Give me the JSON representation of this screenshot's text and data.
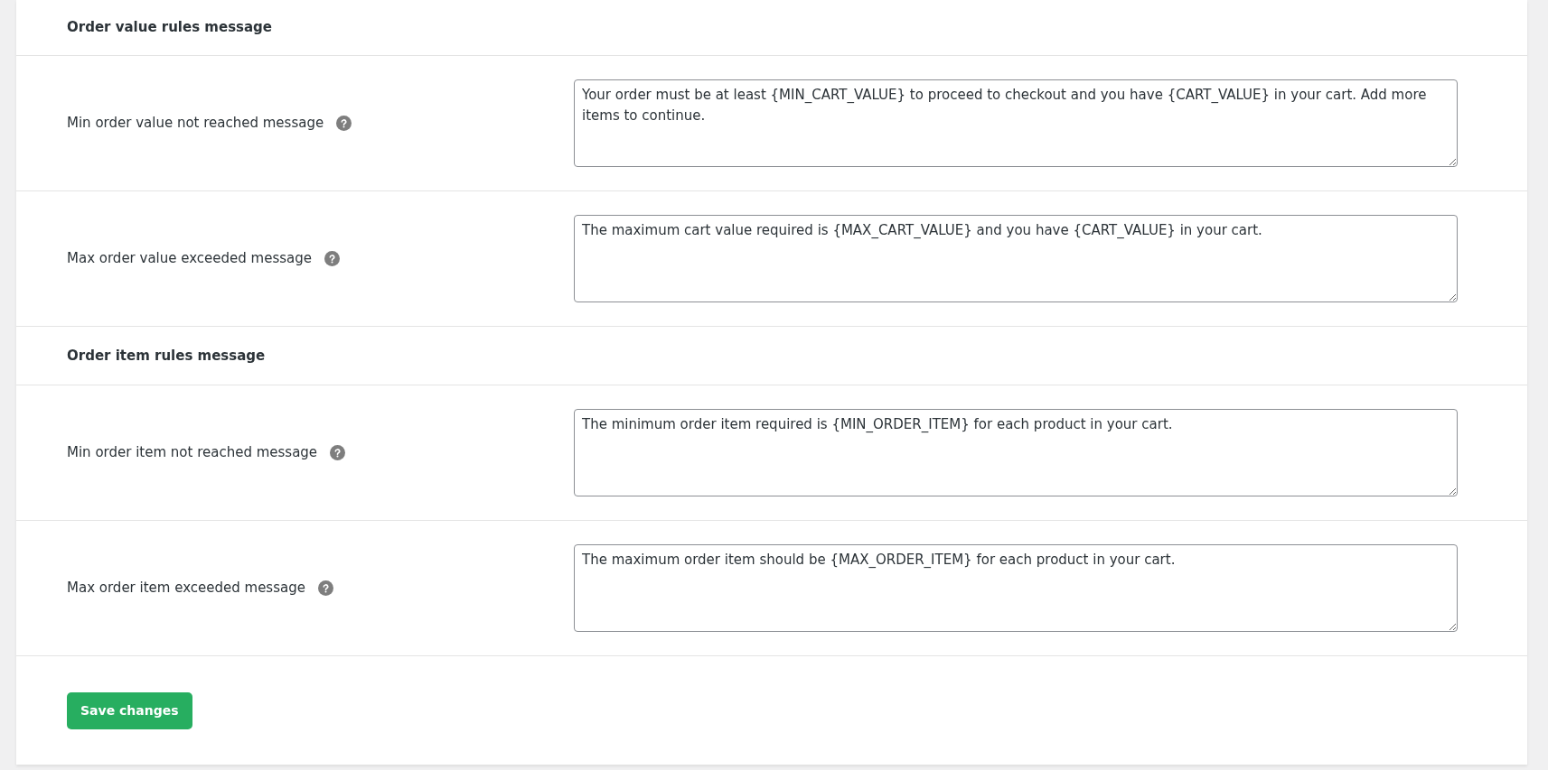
{
  "sections": [
    {
      "title": "Order value rules message",
      "fields": [
        {
          "label": "Min order value not reached message",
          "value": "Your order must be at least {MIN_CART_VALUE} to proceed to checkout and you have {CART_VALUE} in your cart. Add more items to continue."
        },
        {
          "label": "Max order value exceeded message",
          "value": "The maximum cart value required is {MAX_CART_VALUE} and you have {CART_VALUE} in your cart."
        }
      ]
    },
    {
      "title": "Order item rules message",
      "fields": [
        {
          "label": "Min order item not reached message",
          "value": "The minimum order item required is {MIN_ORDER_ITEM} for each product in your cart."
        },
        {
          "label": "Max order item exceeded message",
          "value": "The maximum order item should be {MAX_ORDER_ITEM} for each product in your cart."
        }
      ]
    }
  ],
  "save_button": "Save changes"
}
